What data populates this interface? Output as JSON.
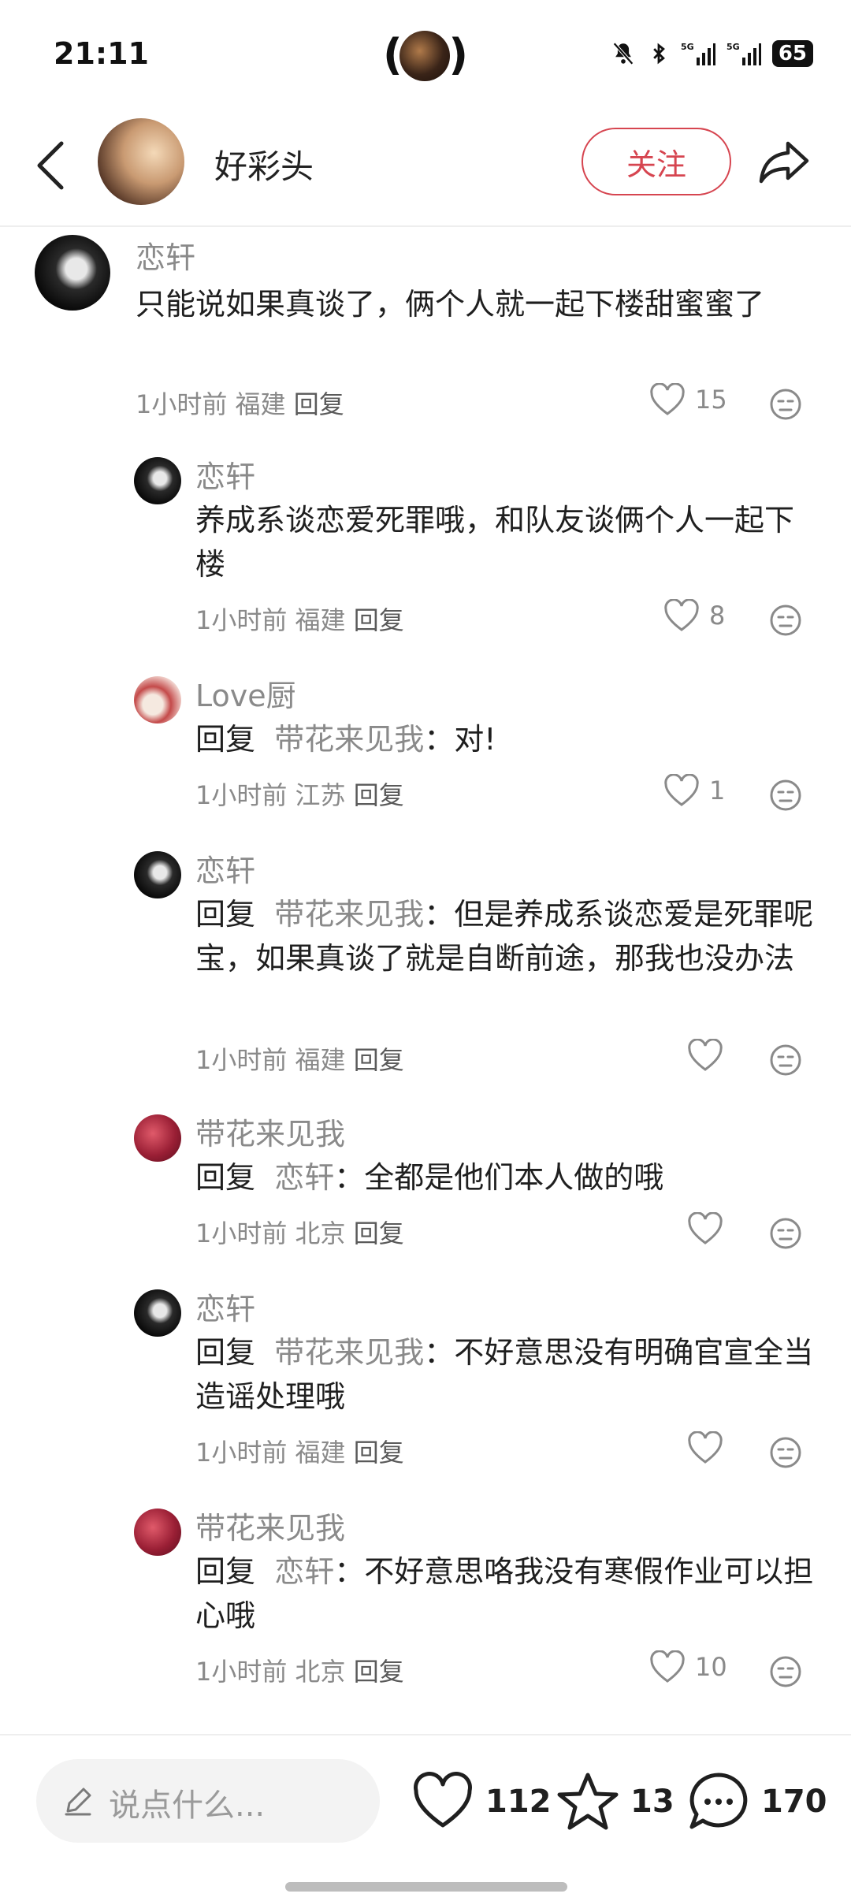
{
  "status_bar": {
    "time": "21:11",
    "battery": "65"
  },
  "header": {
    "title": "好彩头",
    "follow_label": "关注"
  },
  "comments": [
    {
      "name": "恋轩",
      "text": "只能说如果真谈了，俩个人就一起下楼甜蜜蜜了",
      "time": "1小时前",
      "location": "福建",
      "reply_label": "回复",
      "likes": "15"
    },
    {
      "name": "恋轩",
      "text": "养成系谈恋爱死罪哦，和队友谈俩个人一起下楼",
      "time": "1小时前",
      "location": "福建",
      "reply_label": "回复",
      "likes": "8"
    },
    {
      "name": "Love厨",
      "reply_prefix": "回复",
      "target": "带花来见我",
      "colon": "：",
      "text": "对!",
      "time": "1小时前",
      "location": "江苏",
      "reply_label": "回复",
      "likes": "1"
    },
    {
      "name": "恋轩",
      "reply_prefix": "回复",
      "target": "带花来见我",
      "colon": "：",
      "text": "但是养成系谈恋爱是死罪呢宝，如果真谈了就是自断前途，那我也没办法",
      "time": "1小时前",
      "location": "福建",
      "reply_label": "回复",
      "likes": ""
    },
    {
      "name": "带花来见我",
      "reply_prefix": "回复",
      "target": "恋轩",
      "colon": "：",
      "text": "全都是他们本人做的哦",
      "time": "1小时前",
      "location": "北京",
      "reply_label": "回复",
      "likes": ""
    },
    {
      "name": "恋轩",
      "reply_prefix": "回复",
      "target": "带花来见我",
      "colon": "：",
      "text": "不好意思没有明确官宣全当造谣处理哦",
      "time": "1小时前",
      "location": "福建",
      "reply_label": "回复",
      "likes": ""
    },
    {
      "name": "带花来见我",
      "reply_prefix": "回复",
      "target": "恋轩",
      "colon": "：",
      "text": "不好意思咯我没有寒假作业可以担心哦",
      "time": "1小时前",
      "location": "北京",
      "reply_label": "回复",
      "likes": "10"
    }
  ],
  "bottom_bar": {
    "input_placeholder": "说点什么...",
    "likes": "112",
    "favorites": "13",
    "comments": "170"
  }
}
